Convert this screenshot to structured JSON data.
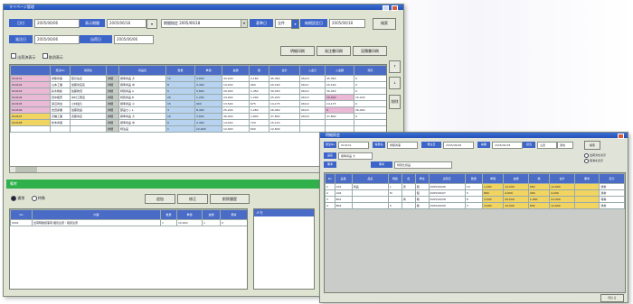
{
  "main_window": {
    "title": "マイページ管理",
    "labels": {
      "start_date": "日付",
      "range": "表示期間",
      "order": "発注日",
      "ship": "出荷日",
      "base_date": "基準日",
      "due": "納期設定日"
    },
    "fields": {
      "start_date": "2005/06/06",
      "range": "2005/06/18",
      "order": "2005/06/06",
      "ship": "2005/06/18",
      "base_date": "2005/06/18",
      "due": "2005/06/06"
    },
    "select_value": "期間指定 2005/06/18",
    "select_small": "全件",
    "top_button": "検索",
    "action_buttons": [
      "明細印刷",
      "発注書印刷",
      "見積書印刷"
    ],
    "checkbox_labels": [
      "出荷済表示",
      "取消表示"
    ],
    "side_buttons": [
      "↑",
      "↓",
      "削除"
    ],
    "grid": {
      "headers": [
        "",
        "受注No",
        "得意先",
        "",
        "商品名",
        "数量",
        "単価",
        "金額",
        "税",
        "合計",
        "入金日",
        "入金額",
        "残高"
      ],
      "rows": [
        [
          "010101",
          "伊藤商事",
          "取引先名",
          "詳細",
          "標準商品 大",
          "12",
          "3,600",
          "43,200",
          "2,160",
          "45,360",
          "06/10",
          "45,360",
          "0"
        ],
        [
          "010102",
          "山本工業",
          "加藤商店名",
          "詳細",
          "標準商品 中",
          "8",
          "2,400",
          "19,200",
          "960",
          "20,160",
          "06/11",
          "20,160",
          "0"
        ],
        [
          "010103",
          "鈴木物産",
          "佐藤物流",
          "詳細",
          "特別商品 A",
          "5",
          "5,800",
          "29,000",
          "1,450",
          "30,450",
          "06/12",
          "30,450",
          "0"
        ],
        [
          "010104",
          "田中販売",
          "中村工務店",
          "詳細",
          "特別商品 B",
          "20",
          "1,200",
          "24,000",
          "1,200",
          "25,200",
          "06/13",
          "10,000",
          "15,200"
        ],
        [
          "010105",
          "渡辺商会",
          "小林電気",
          "詳細",
          "標準商品 小",
          "15",
          "900",
          "13,500",
          "675",
          "14,175",
          "06/14",
          "14,175",
          "0"
        ],
        [
          "010106",
          "吉田産業",
          "加藤建設",
          "詳細",
          "部品セット",
          "3",
          "8,400",
          "25,200",
          "1,260",
          "26,460",
          "06/15",
          "0",
          "26,460"
        ],
        [
          "010107",
          "高橋工業",
          "斎藤商店",
          "詳細",
          "標準商品 大",
          "10",
          "3,600",
          "36,000",
          "1,800",
          "37,800",
          "06/16",
          "37,800",
          "0"
        ],
        [
          "010108",
          "松本商事",
          "",
          "詳細",
          "標準商品 中",
          "6",
          "2,400",
          "14,400",
          "720",
          "15,120",
          "",
          "",
          ""
        ],
        [
          "",
          "",
          "",
          "詳細",
          "特注品",
          "1",
          "12,000",
          "12,000",
          "600",
          "12,600",
          "",
          "",
          ""
        ]
      ]
    },
    "section_title": "備考",
    "radio_labels": [
      "通常",
      "特殊"
    ],
    "lower_buttons": [
      "追加",
      "修正",
      "削除履歴"
    ],
    "lower_grid": {
      "headers": [
        "No",
        "内容",
        "数量",
        "単価",
        "金額",
        "備考"
      ],
      "rows": [
        [
          "0001",
          "出荷時確認事項 梱包注意・取扱注意",
          "1",
          "10,000",
          "1",
          "0"
        ]
      ]
    },
    "side_note_header": "メモ"
  },
  "sub_window": {
    "title": "明細照会",
    "labels": [
      "受注No",
      "得意先",
      "発注日",
      "納期",
      "担当",
      "区分"
    ],
    "fields": [
      "010101",
      "伊藤商事",
      "2005/06/06",
      "2005/06/18",
      "山田",
      "通常"
    ],
    "search_button": "検索",
    "second_labels": [
      "品名",
      "備考"
    ],
    "second_fields": [
      "標準商品 大",
      "特別仕様品"
    ],
    "options": [
      "出荷済を表示",
      "取消を表示"
    ],
    "grid_headers": [
      "No",
      "品番",
      "品名",
      "規格",
      "色",
      "単位",
      "出荷日",
      "数量",
      "単価",
      "金額",
      "税",
      "合計",
      "備考",
      "区分"
    ],
    "grid_rows": [
      [
        "1",
        "A01",
        "商品",
        "L",
        "赤",
        "個",
        "2005/06/06",
        "10",
        "1,200",
        "12,000",
        "600",
        "12,600",
        "",
        "通常"
      ],
      [
        "2",
        "A02",
        "",
        "M",
        "",
        "個",
        "2005/06/07",
        "5",
        "800",
        "4,000",
        "200",
        "4,200",
        "",
        "通常"
      ],
      [
        "3",
        "B01",
        "",
        "",
        "青",
        "箱",
        "2005/06/08",
        "8",
        "2,500",
        "20,000",
        "1,000",
        "21,000",
        "",
        "特殊"
      ],
      [
        "4",
        "B02",
        "",
        "S",
        "",
        "箱",
        "2005/06/09",
        "3",
        "4,000",
        "12,000",
        "600",
        "12,600",
        "",
        "通常"
      ]
    ],
    "footer_button": "閉じる"
  }
}
